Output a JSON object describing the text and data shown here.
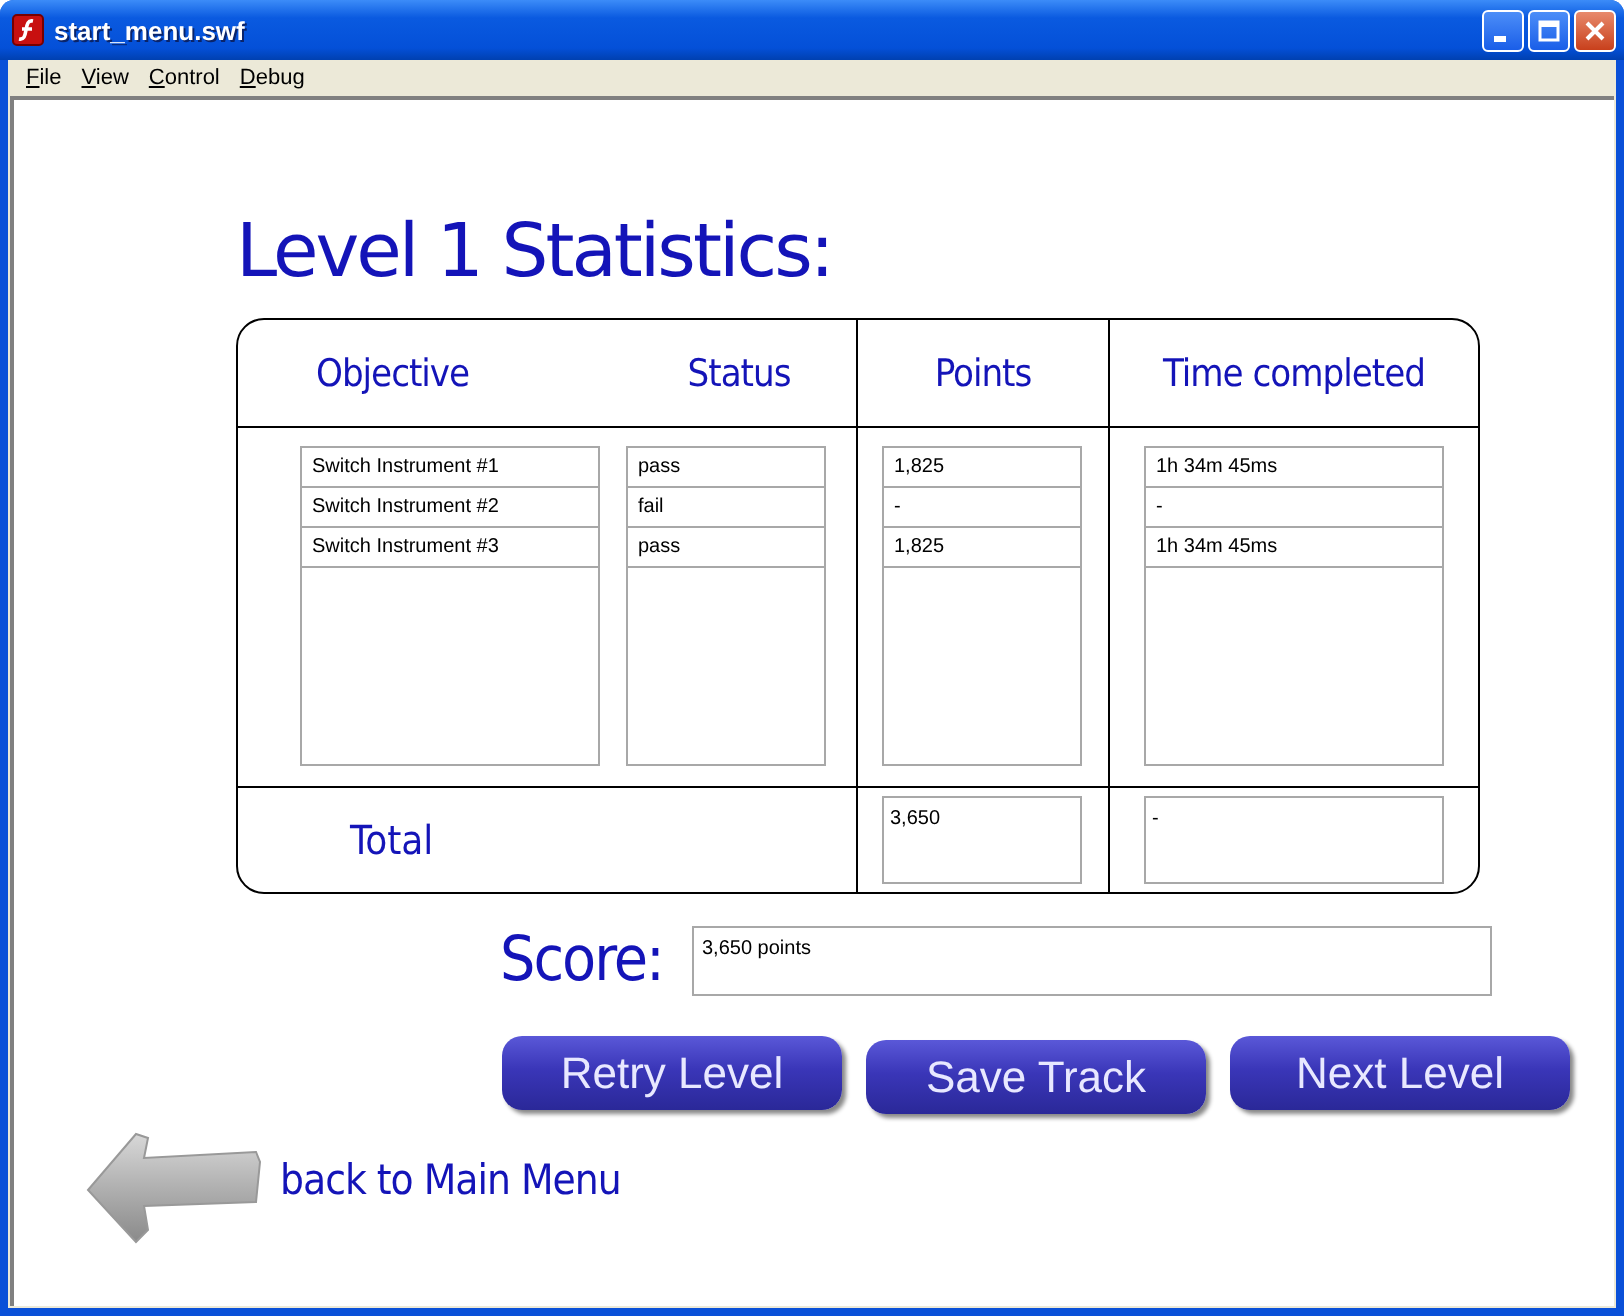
{
  "window": {
    "title": "start_menu.swf"
  },
  "menu": [
    "File",
    "View",
    "Control",
    "Debug"
  ],
  "heading": "Level 1 Statistics:",
  "table": {
    "columns": [
      "Objective",
      "Status",
      "Points",
      "Time completed"
    ],
    "rows": [
      {
        "objective": "Switch Instrument #1",
        "status": "pass",
        "points": "1,825",
        "time": "1h 34m 45ms"
      },
      {
        "objective": "Switch Instrument #2",
        "status": "fail",
        "points": "-",
        "time": "-"
      },
      {
        "objective": "Switch Instrument #3",
        "status": "pass",
        "points": "1,825",
        "time": "1h 34m 45ms"
      }
    ],
    "total": {
      "label": "Total",
      "points": "3,650",
      "time": "-"
    }
  },
  "score": {
    "label": "Score:",
    "value": "3,650 points"
  },
  "buttons": [
    "Retry Level",
    "Save Track",
    "Next Level"
  ],
  "back_link": "back to Main Menu"
}
